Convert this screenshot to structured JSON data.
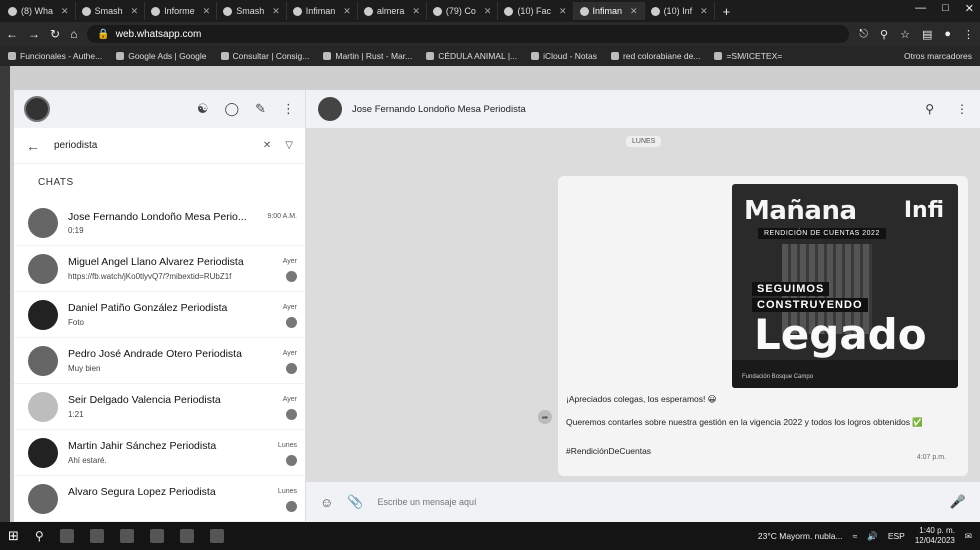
{
  "browser": {
    "tabs": [
      {
        "label": "(8) Wha",
        "active": false
      },
      {
        "label": "Smash",
        "active": false
      },
      {
        "label": "Informe",
        "active": false
      },
      {
        "label": "Smash",
        "active": false
      },
      {
        "label": "Infiman",
        "active": false
      },
      {
        "label": "almera",
        "active": false
      },
      {
        "label": "(79) Co",
        "active": false
      },
      {
        "label": "(10) Fac",
        "active": false
      },
      {
        "label": "Infiman",
        "active": true
      },
      {
        "label": "(10) Inf",
        "active": false
      }
    ],
    "new_tab": "+",
    "url": "web.whatsapp.com",
    "bookmarks": [
      "Funcionales - Authe...",
      "Google Ads | Google",
      "Consultar | Consig...",
      "Martin | Rust - Mar...",
      "CÉDULA ANIMAL |...",
      "iCloud - Notas",
      "red colorabiane de...",
      "=SM/ICETEX="
    ],
    "other_bookmarks": "Otros marcadores"
  },
  "sidebar": {
    "search_value": "periodista",
    "chats_label": "CHATS",
    "chats": [
      {
        "name": "Jose Fernando Londoño Mesa Perio...",
        "time": "9:00 A.M.",
        "preview": "0:19",
        "avatar": "mid"
      },
      {
        "name": "Miguel Angel Llano Alvarez Periodista",
        "time": "Ayer",
        "preview": "https://fb.watch/jKo0tlyvQ7/?mibextid=RUbZ1f",
        "avatar": "mid"
      },
      {
        "name": "Daniel Patiño González Periodista",
        "time": "Ayer",
        "preview": "Foto",
        "avatar": "dark"
      },
      {
        "name": "Pedro José Andrade Otero Periodista",
        "time": "Ayer",
        "preview": "Muy bien",
        "avatar": "mid"
      },
      {
        "name": "Seir Delgado Valencia Periodista",
        "time": "Ayer",
        "preview": "1:21",
        "avatar": "light"
      },
      {
        "name": "Martin Jahir Sánchez Periodista",
        "time": "Lunes",
        "preview": "Ahí estaré.",
        "avatar": "dark"
      },
      {
        "name": "Alvaro Segura Lopez Periodista",
        "time": "Lunes",
        "preview": "",
        "avatar": "mid"
      }
    ]
  },
  "conversation": {
    "contact_name": "Jose Fernando Londoño Mesa Periodista",
    "day_label": "LUNES",
    "poster": {
      "headline": "Mañana",
      "brand": "Infi",
      "subtitle": "RENDICIÓN DE CUENTAS 2022",
      "line1": "SEGUIMOS",
      "line2": "CONSTRUYENDO",
      "big": "Legado",
      "footer": "Fundación Bosque Campo"
    },
    "messages": [
      "¡Apreciados colegas, los esperamos! 😀",
      "Queremos contarles sobre nuestra gestión en la vigencia 2022 y todos los logros obtenidos ✅",
      "#RendiciónDeCuentas"
    ],
    "message_time": "4:07 p.m.",
    "composer_placeholder": "Escribe un mensaje aquí"
  },
  "taskbar": {
    "weather": "23°C  Mayorm. nubla...",
    "language": "ESP",
    "time": "1:40 p. m.",
    "date": "12/04/2023"
  }
}
